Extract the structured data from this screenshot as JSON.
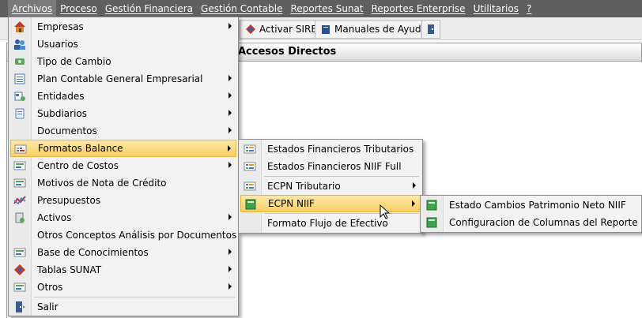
{
  "menubar": [
    "Archivos",
    "Proceso",
    "Gestión Financiera",
    "Gestión Contable",
    "Reportes Sunat",
    "Reportes Enterprise",
    "Utilitarios",
    "?"
  ],
  "toolbar": {
    "btn1": "Activar SIRE",
    "btn2": "Manuales de Ayuda"
  },
  "panel": {
    "title": "Accesos Directos"
  },
  "archivos_menu": [
    {
      "label": "Empresas",
      "icon": "house-icon",
      "sub": true
    },
    {
      "label": "Usuarios",
      "icon": "users-icon",
      "sub": false
    },
    {
      "label": "Tipo de Cambio",
      "icon": "exchange-icon",
      "sub": false
    },
    {
      "label": "Plan Contable General Empresarial",
      "icon": "list-icon",
      "sub": true
    },
    {
      "label": "Entidades",
      "icon": "entity-icon",
      "sub": true
    },
    {
      "label": "Subdiarios",
      "icon": "subdiary-icon",
      "sub": true
    },
    {
      "label": "Documentos",
      "icon": "",
      "sub": true
    },
    {
      "label": "Formatos Balance",
      "icon": "balance-icon",
      "sub": true
    },
    {
      "label": "Centro de Costos",
      "icon": "form-icon",
      "sub": true
    },
    {
      "label": "Motivos de Nota de Crédito",
      "icon": "form-icon",
      "sub": false
    },
    {
      "label": "Presupuestos",
      "icon": "chart-icon",
      "sub": false
    },
    {
      "label": "Activos",
      "icon": "assets-icon",
      "sub": true
    },
    {
      "label": "Otros Conceptos Análisis por Documentos",
      "icon": "",
      "sub": false
    },
    {
      "label": "Base de Conocimientos",
      "icon": "form-icon",
      "sub": true
    },
    {
      "label": "Tablas SUNAT",
      "icon": "sunat-icon",
      "sub": true
    },
    {
      "label": "Otros",
      "icon": "form-icon",
      "sub": true
    },
    {
      "label": "Salir",
      "icon": "exit-icon",
      "sub": false
    }
  ],
  "formatos_menu": [
    {
      "label": "Estados Financieros Tributarios",
      "sub": false
    },
    {
      "label": "Estados Financieros NIIF Full",
      "sub": false
    },
    {
      "label": "ECPN Tributario",
      "sub": true
    },
    {
      "label": "ECPN NIIF",
      "sub": true
    },
    {
      "label": "Formato Flujo de Efectivo",
      "sub": false
    }
  ],
  "ecpn_menu": [
    {
      "label": "Estado Cambios Patrimonio Neto NIIF"
    },
    {
      "label": "Configuracion de Columnas del Reporte"
    }
  ]
}
